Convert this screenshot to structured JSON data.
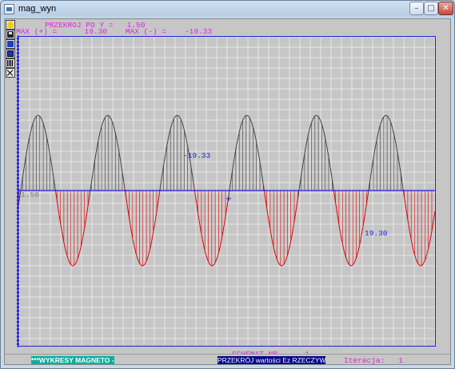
{
  "window": {
    "title": "mag_wyn"
  },
  "title_buttons": {
    "minimize": "–",
    "maximize": "□",
    "close": "✕"
  },
  "toolbar": {
    "icons": [
      "lamp-icon",
      "save-icon",
      "print-icon",
      "copy-icon",
      "grid-icon",
      "exit-icon"
    ]
  },
  "header": {
    "line1": "PRZEKROJ PO Y =   1.50",
    "line2": "MAX (+) =      19.30    MAX (-) =    -19.33"
  },
  "annotations": {
    "min_label": "-19.33",
    "max_label": "19.30",
    "axis_label": "1.50"
  },
  "footer": {
    "schemat": "SCHEMAT NR      1",
    "iteracja": "Iteracja:   1",
    "green_tab": "***WYKRESY MAGNETO - MES",
    "blue_tab": "PRZEKRÓJ wartości Ez RZECZYWISTE"
  },
  "colors": {
    "positive": "#e00000",
    "negative": "#404040",
    "axis": "#2020e0",
    "frame": "#2020e0",
    "grid": "#e6e6e6"
  },
  "chart_data": {
    "type": "line",
    "periods": 6,
    "max": 19.3,
    "min": -19.33,
    "y_level": 1.5
  }
}
